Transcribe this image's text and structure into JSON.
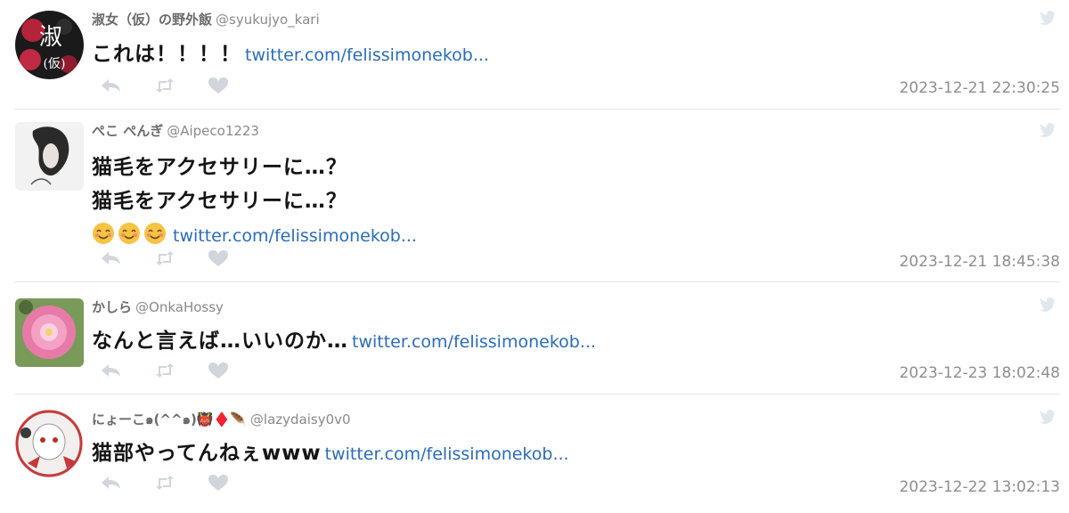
{
  "tweets": [
    {
      "name": "淑女（仮）の野外飯",
      "handle": "@syukujyo_kari",
      "lines": [
        "これは！！！！"
      ],
      "link": "twitter.com/felissimonekob...",
      "time": "2023-12-21 22:30:25",
      "avatar_text": "淑女(仮)"
    },
    {
      "name": "ぺこ ぺんぎ",
      "handle": "@Aipeco1223",
      "lines": [
        "猫毛をアクセサリーに…？",
        "猫毛をアクセサリーに…？"
      ],
      "link": "twitter.com/felissimonekob...",
      "time": "2023-12-21 18:45:38"
    },
    {
      "name": "かしら",
      "handle": "@OnkaHossy",
      "lines": [
        "なんと言えば…いいのか…"
      ],
      "link": "twitter.com/felissimonekob...",
      "time": "2023-12-23 18:02:48"
    },
    {
      "name": "にょーこ๑(^^๑)👹♦️🪶",
      "handle": "@lazydaisy0v0",
      "lines": [
        "猫部やってんねぇwww"
      ],
      "link": "twitter.com/felissimonekob...",
      "time": "2023-12-22 13:02:13"
    }
  ],
  "icons": {
    "reply": "reply-icon",
    "retweet": "retweet-icon",
    "like": "heart-icon",
    "brand": "twitter-bird-icon"
  },
  "colors": {
    "link": "#2b6cb7",
    "muted": "#8e8e8e",
    "icon": "#d0d6db"
  }
}
